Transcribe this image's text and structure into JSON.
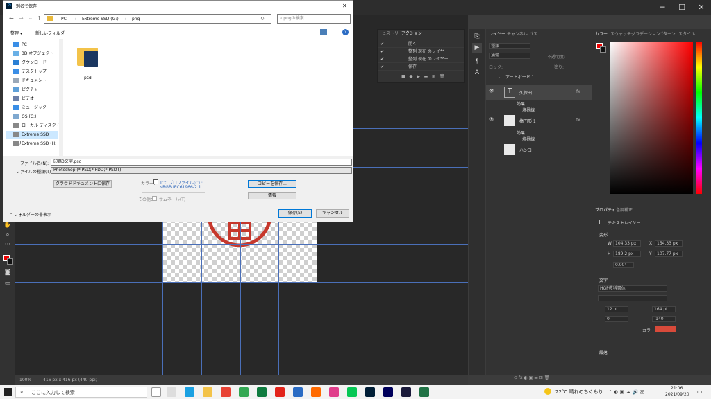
{
  "app": {
    "icon_text": "Ps"
  },
  "dialog": {
    "title": "別名で保存",
    "close": "✕",
    "breadcrumb": [
      "PC",
      "Extreme SSD (G:)",
      "png"
    ],
    "search_placeholder": "pngの検索",
    "toolbar": {
      "organize": "整理 ▾",
      "new_folder": "新しいフォルダー"
    },
    "nav_items": [
      "PC",
      "3D オブジェクト",
      "ダウンロード",
      "デスクトップ",
      "ドキュメント",
      "ピクチャ",
      "ビデオ",
      "ミュージック",
      "OS (C:)",
      "ローカル ディスク (D",
      "Extreme SSD (G:)",
      "Extreme SSD (H:"
    ],
    "folder_name": "psd",
    "filename_label": "ファイル名(N):",
    "filename_value": "印鑑3文字.psd",
    "filetype_label": "ファイルの種類(T):",
    "filetype_value": "Photoshop (*.PSD;*.PDD;*.PSDT)",
    "cloud_save_button": "クラウドドキュメントに保存",
    "color_label": "カラー：",
    "icc_label": "ICC プロファイル(C) :",
    "icc_profile": "sRGB IEC61966-2.1",
    "other_label": "その他：",
    "thumbnail_label": "サムネール(T)",
    "copy_save_button": "コピーを保存...",
    "info_button": "情報",
    "hide_folders": "フォルダーの非表示",
    "save_button": "保存(S)",
    "cancel_button": "キャンセル"
  },
  "actions_panel": {
    "tabs": [
      "ヒストリー",
      "アクション"
    ],
    "rows": [
      "開く",
      "整列 現在 のレイヤー",
      "整列 現在 のレイヤー",
      "保存"
    ]
  },
  "layers_panel": {
    "tabs": [
      "レイヤー",
      "チャンネル",
      "パス"
    ],
    "search_kind": "種類",
    "blend_mode": "通常",
    "opacity_label": "不透明度:",
    "lock_label": "ロック:",
    "fill_label": "塗り:",
    "artboard": "アートボード 1",
    "layers": [
      {
        "name": "久保田",
        "fx": "fx",
        "effects": [
          "効果",
          "境界線"
        ]
      },
      {
        "name": "楕円形 1",
        "fx": "fx",
        "effects": [
          "効果",
          "境界線"
        ]
      },
      {
        "name": "ハンコ"
      }
    ]
  },
  "right_panel": {
    "tabs": [
      "カラー",
      "スウォッチ",
      "グラデーション",
      "パターン",
      "スタイル"
    ],
    "properties_tabs": [
      "プロパティ",
      "色調補正"
    ],
    "properties_kind": "テキストレイヤー",
    "transform_label": "変形",
    "w_label": "W",
    "w_value": "104.33 px",
    "x_label": "X",
    "x_value": "154.33 px",
    "h_label": "H",
    "h_value": "189.2 px",
    "y_label": "Y",
    "y_value": "107.77 px",
    "angle_value": "0.00°",
    "text_label": "文字",
    "font_name": "HGP教科書体",
    "font_size": "12 pt",
    "leading": "164 pt",
    "kerning": "0",
    "tracking": "-140",
    "color_label": "カラー:",
    "paragraph_label": "段落",
    "text_color": "#d84a3a"
  },
  "status": {
    "zoom": "100%",
    "doc_size": "416 px x 416 px (440 ppi)"
  },
  "taskbar": {
    "search_placeholder": "ここに入力して検索",
    "weather": "22°C 晴れのちくもり",
    "time": "21:06",
    "date": "2021/09/20"
  }
}
